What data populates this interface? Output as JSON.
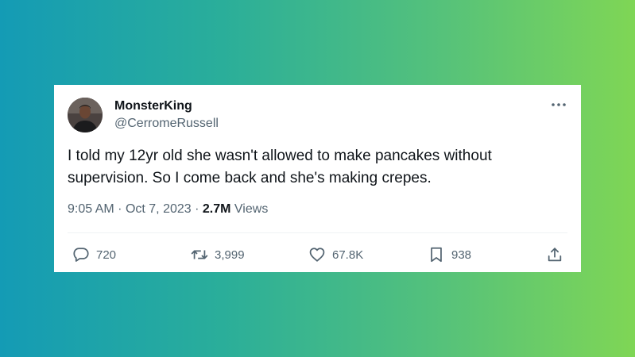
{
  "tweet": {
    "author": {
      "name": "MonsterKing",
      "handle": "@CerromeRussell",
      "avatar_icon": "user-avatar"
    },
    "text": "I told my 12yr old she wasn't allowed to make pancakes without supervision. So I come back and she's making crepes.",
    "meta": {
      "time": "9:05 AM",
      "separator": "·",
      "date": "Oct 7, 2023",
      "views_count": "2.7M",
      "views_label": "Views"
    },
    "actions": {
      "replies": "720",
      "retweets": "3,999",
      "likes": "67.8K",
      "bookmarks": "938"
    },
    "icons": {
      "reply": "reply-icon",
      "retweet": "retweet-icon",
      "like": "heart-icon",
      "bookmark": "bookmark-icon",
      "share": "share-icon",
      "more": "more-icon"
    }
  },
  "colors": {
    "background_gradient_start": "#149bb5",
    "background_gradient_end": "#7fd655",
    "text_primary": "#0f1419",
    "text_secondary": "#536471"
  }
}
